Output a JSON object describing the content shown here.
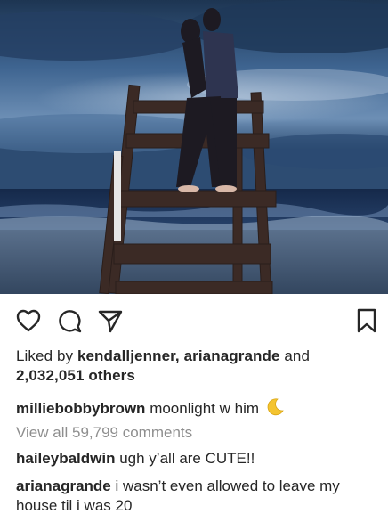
{
  "post": {
    "likes": {
      "prefix": "Liked by",
      "user1": "kendalljenner",
      "separator": ",",
      "user2": "ariánagrande",
      "conjunction": "and",
      "count": "2,032,051 others"
    },
    "caption": {
      "username": "milliebobbybrown",
      "text": "moonlight w him",
      "emoji": "crescent-moon-icon"
    },
    "view_all_comments": "View all 59,799 comments",
    "comments": [
      {
        "username": "haileybaldwin",
        "text": "ugh y’all are CUTE!!"
      },
      {
        "username": "arianagrande",
        "text": "i wasn’t even allowed to leave my house til i was 20"
      }
    ]
  },
  "icons": [
    "heart-icon",
    "comment-icon",
    "share-icon",
    "bookmark-icon"
  ],
  "colors": {
    "text": "#262626",
    "muted": "#8e8e8e",
    "sky": "#3a5a86",
    "moon": "#f4c430"
  }
}
